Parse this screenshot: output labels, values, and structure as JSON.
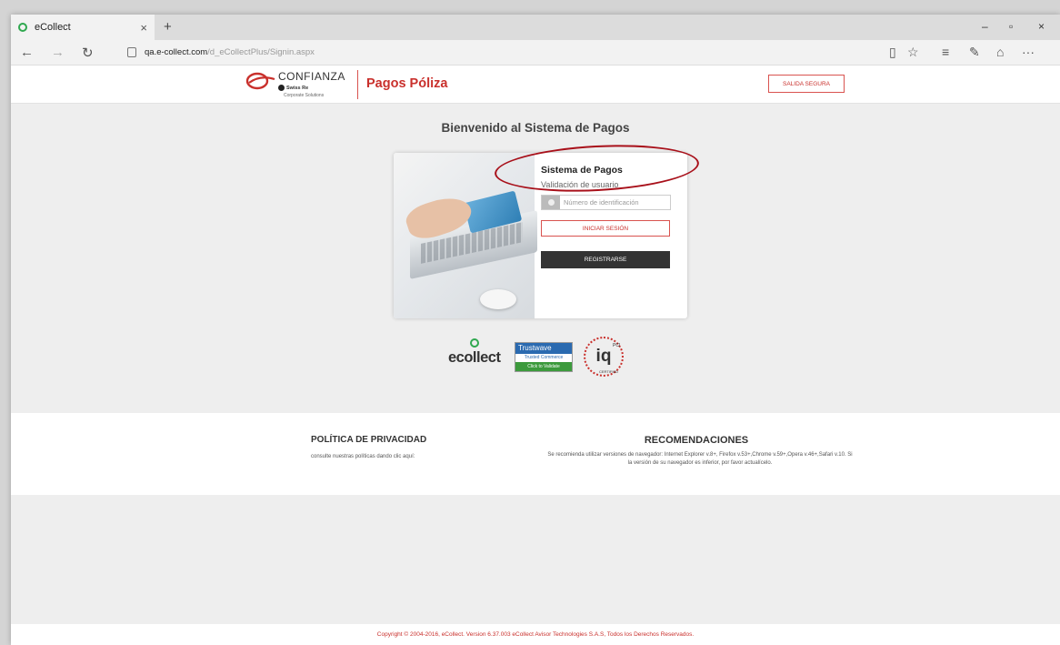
{
  "browser": {
    "tab_title": "eCollect",
    "tab_close": "×",
    "new_tab": "+",
    "url_domain": "qa.e-collect.com",
    "url_path": "/d_eCollectPlus/Signin.aspx",
    "nav_back": "←",
    "nav_forward": "→",
    "nav_refresh": "↻",
    "win_min": "–",
    "win_max": "▫",
    "win_close": "×",
    "toolbar_reading": "▯",
    "toolbar_star": "☆",
    "toolbar_hub": "≡",
    "toolbar_notes": "✎",
    "toolbar_share": "⌂",
    "toolbar_more": "···"
  },
  "header": {
    "brand": "CONFIANZA",
    "sub_brand": "Swiss Re",
    "sub_brand_line": "Corporate Solutions",
    "site_title": "Pagos Póliza",
    "exit_button": "SALIDA SEGURA",
    "accent_color": "#c9302c"
  },
  "main": {
    "welcome": "Bienvenido al Sistema de Pagos",
    "card": {
      "title": "Sistema de Pagos",
      "subtitle": "Validación de usuario",
      "id_placeholder": "Número de identificación",
      "login_button": "INICIAR SESIÓN",
      "register_button": "REGISTRARSE"
    },
    "badges": {
      "ecollect": "ecollect",
      "trustwave_top": "Trustwave",
      "trustwave_mid": "Trusted Commerce",
      "trustwave_bottom": "Click to Validate",
      "iq": "iq",
      "pci": "PCI",
      "certified": "CERTIFIED"
    }
  },
  "footer": {
    "privacy_title": "POLÍTICA DE PRIVACIDAD",
    "privacy_text": "consulte nuestras políticas dando clic aquí:",
    "rec_title": "RECOMENDACIONES",
    "rec_text": "Se recomienda utilizar versiones de navegador: Internet Explorer v.8+, Firefox v.53+,Chrome v.59+,Opera v.46+,Safari v.10. Si la versión de su navegador es inferior, por favor actualícelo.",
    "copyright": "Copyright © 2004-2016, eCollect. Version 6.37.003 eCollect Avisor Technologies S.A.S, Todos los Derechos Reservados."
  }
}
